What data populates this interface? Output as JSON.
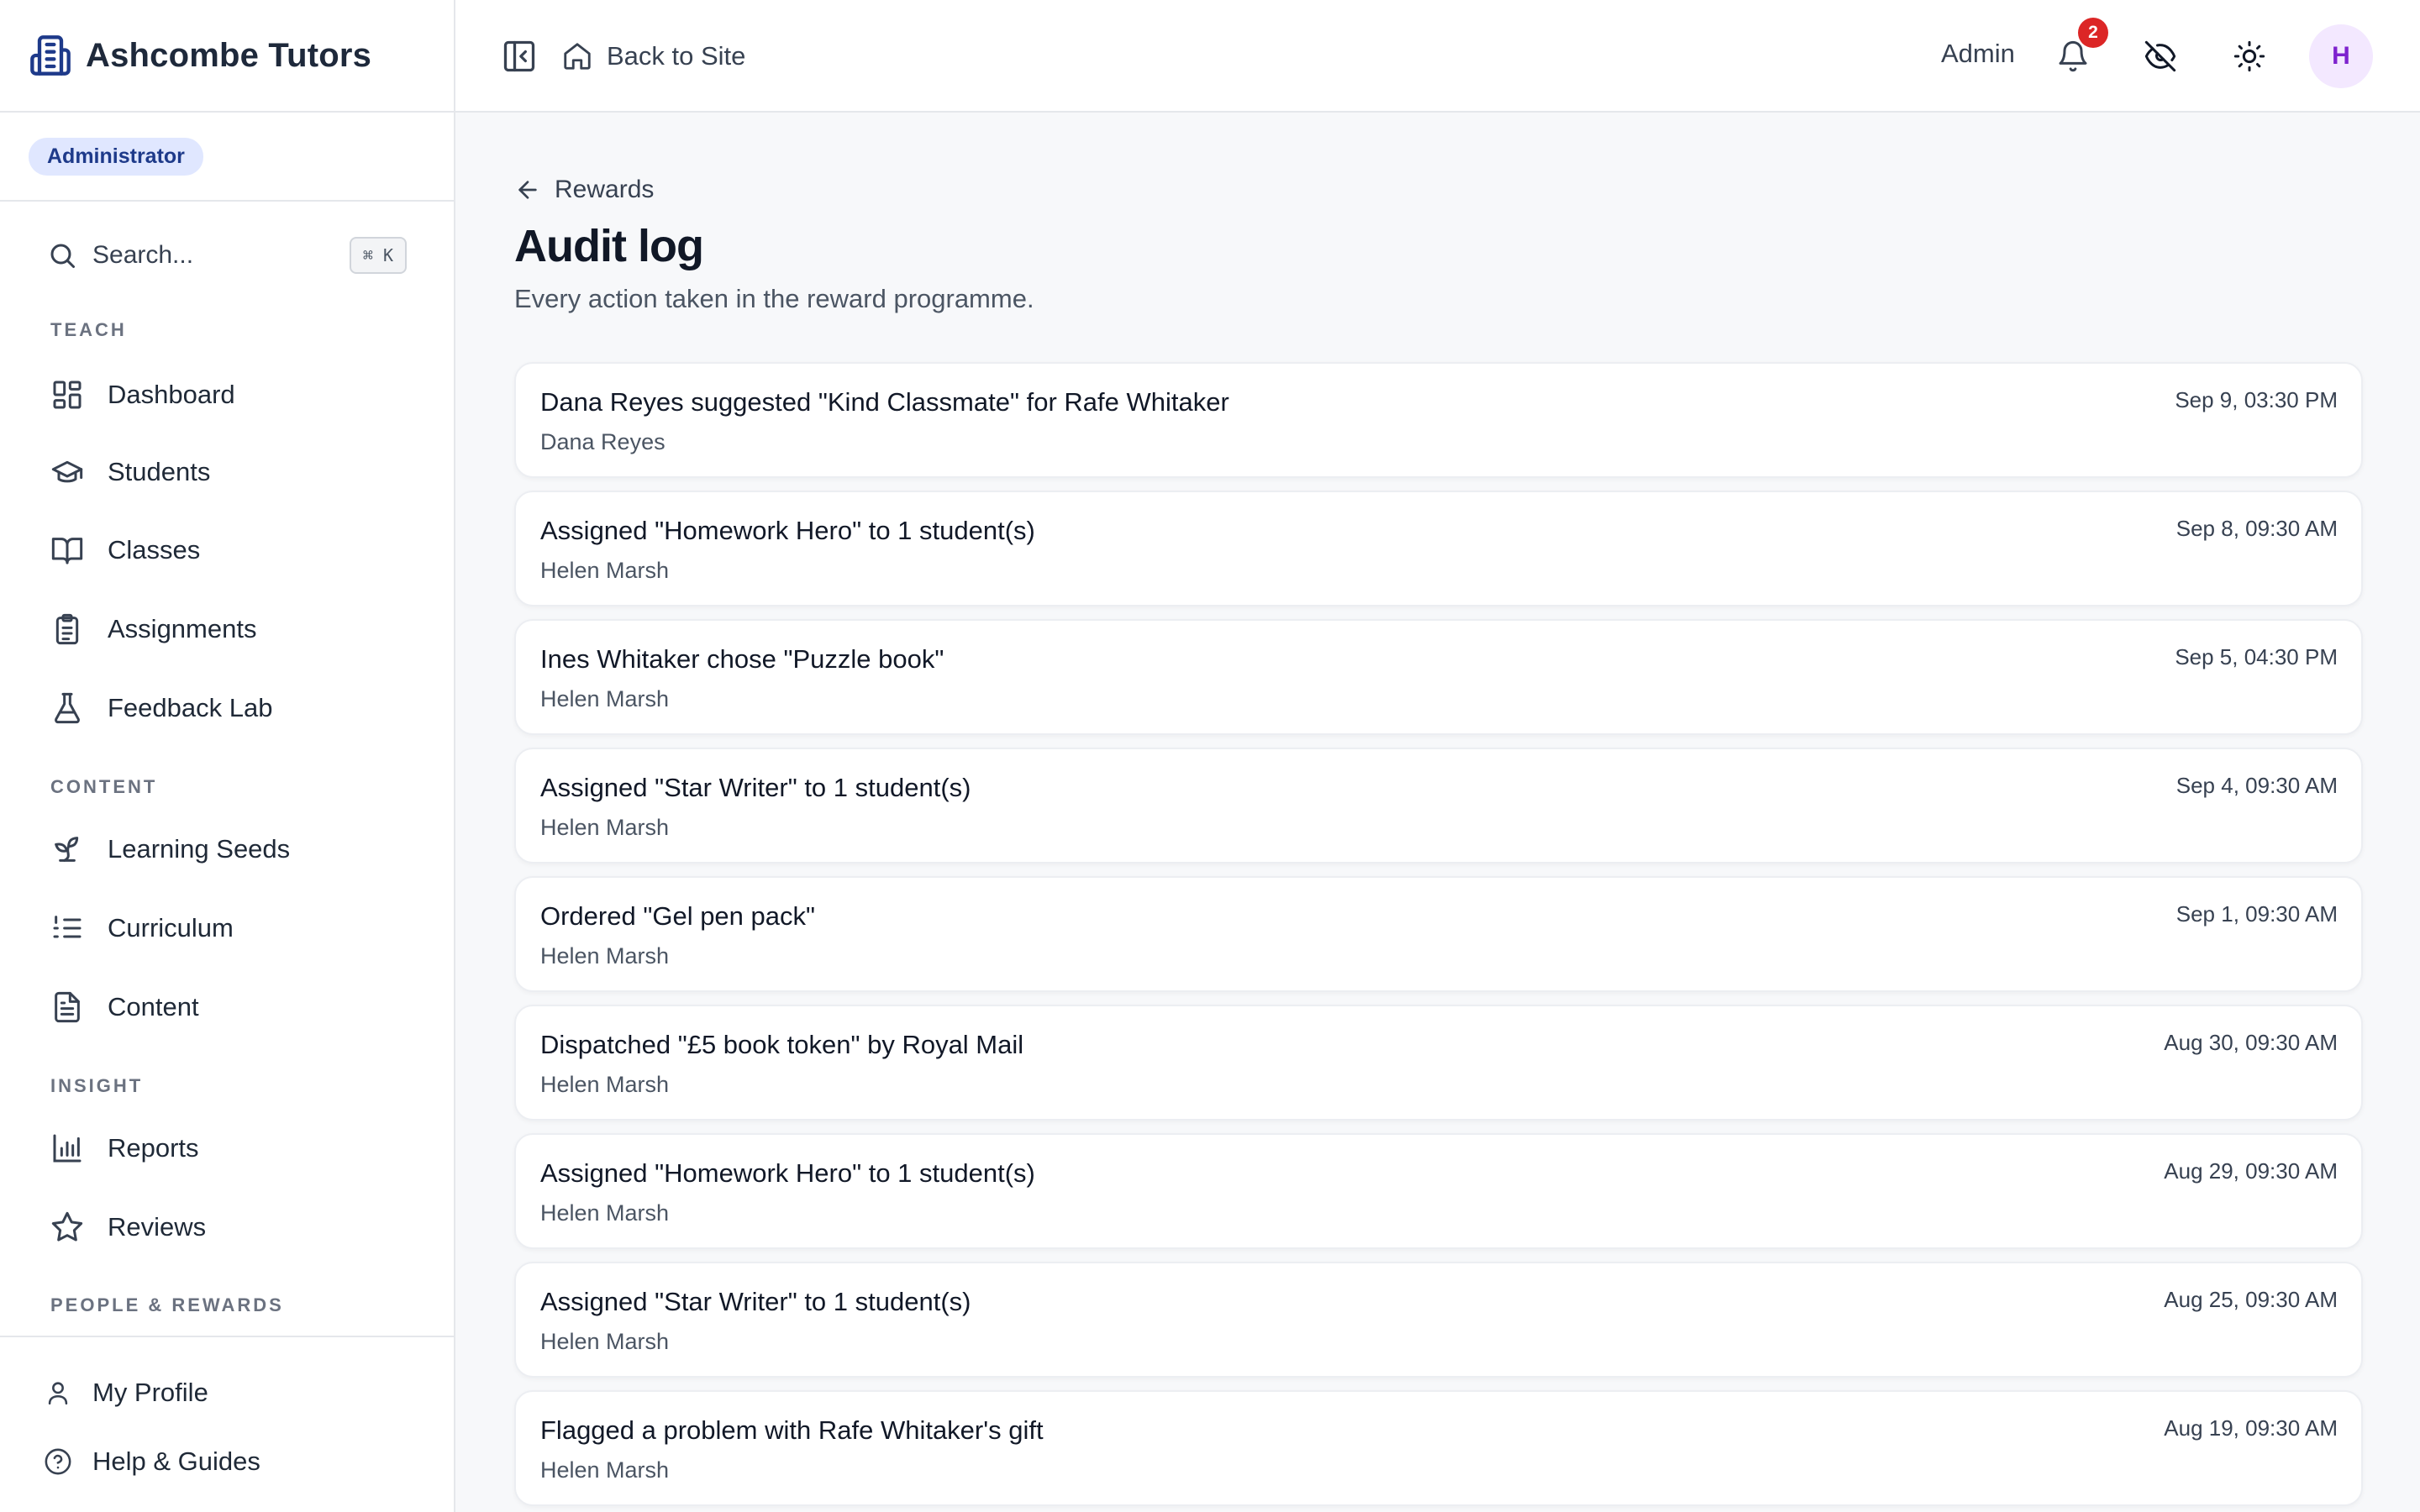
{
  "brand": {
    "name": "Ashcombe Tutors"
  },
  "role_badge": "Administrator",
  "search": {
    "label": "Search...",
    "shortcut": "⌘ K"
  },
  "sidebar": {
    "sections": {
      "teach": "TEACH",
      "content": "CONTENT",
      "insight": "INSIGHT",
      "people": "PEOPLE & REWARDS"
    },
    "items": {
      "dashboard": "Dashboard",
      "students": "Students",
      "classes": "Classes",
      "assignments": "Assignments",
      "feedback_lab": "Feedback Lab",
      "learning_seeds": "Learning Seeds",
      "curriculum": "Curriculum",
      "content": "Content",
      "reports": "Reports",
      "reviews": "Reviews"
    },
    "footer": {
      "profile": "My Profile",
      "help": "Help & Guides"
    }
  },
  "topbar": {
    "back_to_site": "Back to Site",
    "admin_label": "Admin",
    "notification_count": "2",
    "avatar_initial": "H"
  },
  "main": {
    "breadcrumb": "Rewards",
    "title": "Audit log",
    "subtitle": "Every action taken in the reward programme.",
    "entries": [
      {
        "action": "Dana Reyes suggested \"Kind Classmate\" for Rafe Whitaker",
        "actor": "Dana Reyes",
        "time": "Sep 9, 03:30 PM"
      },
      {
        "action": "Assigned \"Homework Hero\" to 1 student(s)",
        "actor": "Helen Marsh",
        "time": "Sep 8, 09:30 AM"
      },
      {
        "action": "Ines Whitaker chose \"Puzzle book\"",
        "actor": "Helen Marsh",
        "time": "Sep 5, 04:30 PM"
      },
      {
        "action": "Assigned \"Star Writer\" to 1 student(s)",
        "actor": "Helen Marsh",
        "time": "Sep 4, 09:30 AM"
      },
      {
        "action": "Ordered \"Gel pen pack\"",
        "actor": "Helen Marsh",
        "time": "Sep 1, 09:30 AM"
      },
      {
        "action": "Dispatched \"£5 book token\" by Royal Mail",
        "actor": "Helen Marsh",
        "time": "Aug 30, 09:30 AM"
      },
      {
        "action": "Assigned \"Homework Hero\" to 1 student(s)",
        "actor": "Helen Marsh",
        "time": "Aug 29, 09:30 AM"
      },
      {
        "action": "Assigned \"Star Writer\" to 1 student(s)",
        "actor": "Helen Marsh",
        "time": "Aug 25, 09:30 AM"
      },
      {
        "action": "Flagged a problem with Rafe Whitaker's gift",
        "actor": "Helen Marsh",
        "time": "Aug 19, 09:30 AM"
      }
    ]
  },
  "colors": {
    "brand_icon": "#1e3a8a",
    "badge_bg": "#e0e7ff",
    "notification": "#dc2626",
    "avatar_bg": "#f3e8ff",
    "avatar_text": "#7e22ce"
  }
}
